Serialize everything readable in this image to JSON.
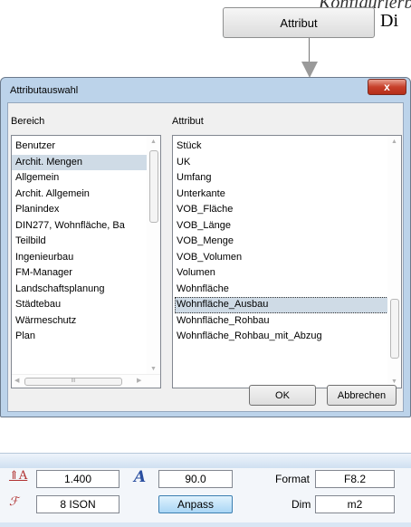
{
  "top": {
    "cut_text": "Konfigurierbar",
    "attribut_button": "Attribut",
    "di_text": "Di"
  },
  "dialog": {
    "title": "Attributauswahl",
    "close_glyph": "x",
    "bereich_label": "Bereich",
    "attribut_label": "Attribut",
    "bereich_items": [
      "Benutzer",
      "Archit. Mengen",
      "Allgemein",
      "Archit. Allgemein",
      "Planindex",
      "DIN277, Wohnfläche, Ba",
      "Teilbild",
      "Ingenieurbau",
      "FM-Manager",
      "Landschaftsplanung",
      "Städtebau",
      "Wärmeschutz",
      "Plan"
    ],
    "bereich_selected": "Archit. Mengen",
    "attribut_items": [
      "Stück",
      "UK",
      "Umfang",
      "Unterkante",
      "VOB_Fläche",
      "VOB_Länge",
      "VOB_Menge",
      "VOB_Volumen",
      "Volumen",
      "Wohnfläche",
      "Wohnfläche_Ausbau",
      "Wohnfläche_Rohbau",
      "Wohnfläche_Rohbau_mit_Abzug"
    ],
    "attribut_selected": "Wohnfläche_Ausbau",
    "ok_label": "OK",
    "cancel_label": "Abbrechen",
    "hscroll_grip": "III"
  },
  "panel": {
    "height_value": "1.400",
    "angle_value": "90.0",
    "pen_value": "8 ISON",
    "anpass_label": "Anpass",
    "format_label": "Format",
    "format_value": "F8.2",
    "dim_label": "Dim",
    "dim_value": "m2",
    "text_height_icon": "text-height-icon",
    "text_angle_icon": "text-angle-icon",
    "font_icon": "font-icon"
  },
  "colors": {
    "dialog_frame": "#bcd3ea",
    "selection_gray": "#cfdbe6",
    "close_red": "#c7402b"
  }
}
